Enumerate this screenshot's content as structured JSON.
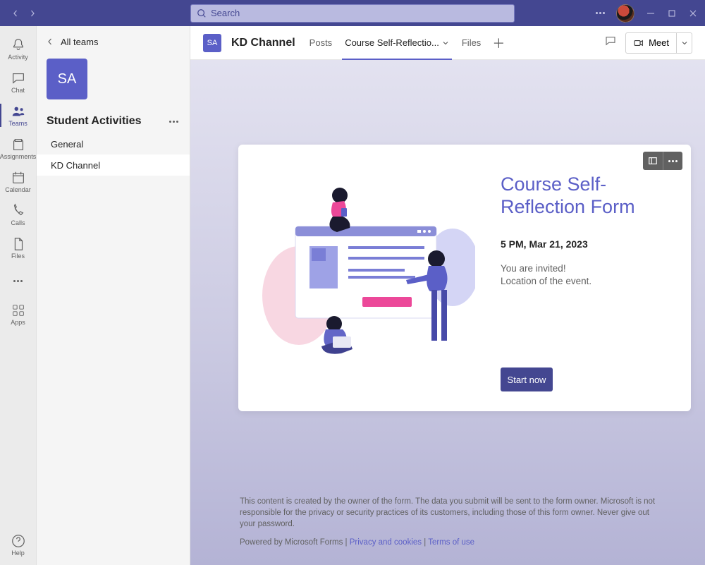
{
  "title": {
    "search_placeholder": "Search"
  },
  "rail": {
    "activity": "Activity",
    "chat": "Chat",
    "teams": "Teams",
    "assignments": "Assignments",
    "calendar": "Calendar",
    "calls": "Calls",
    "files": "Files",
    "apps": "Apps",
    "help": "Help"
  },
  "sidebar": {
    "back": "All teams",
    "tile": "SA",
    "team": "Student Activities",
    "channels": [
      "General",
      "KD Channel"
    ]
  },
  "header": {
    "tile": "SA",
    "title": "KD Channel",
    "tabs": {
      "posts": "Posts",
      "active": "Course Self-Reflectio...",
      "files": "Files"
    },
    "meet": "Meet"
  },
  "form": {
    "title": "Course Self-Reflection Form",
    "date": "5 PM, Mar 21, 2023",
    "line1": "You are invited!",
    "line2": "Location of the event.",
    "start": "Start now"
  },
  "footer": {
    "disclaimer": "This content is created by the owner of the form. The data you submit will be sent to the form owner. Microsoft is not responsible for the privacy or security practices of its customers, including those of this form owner. Never give out your password.",
    "powered": "Powered by Microsoft Forms",
    "sep": " | ",
    "privacy": "Privacy and cookies",
    "terms": "Terms of use"
  }
}
